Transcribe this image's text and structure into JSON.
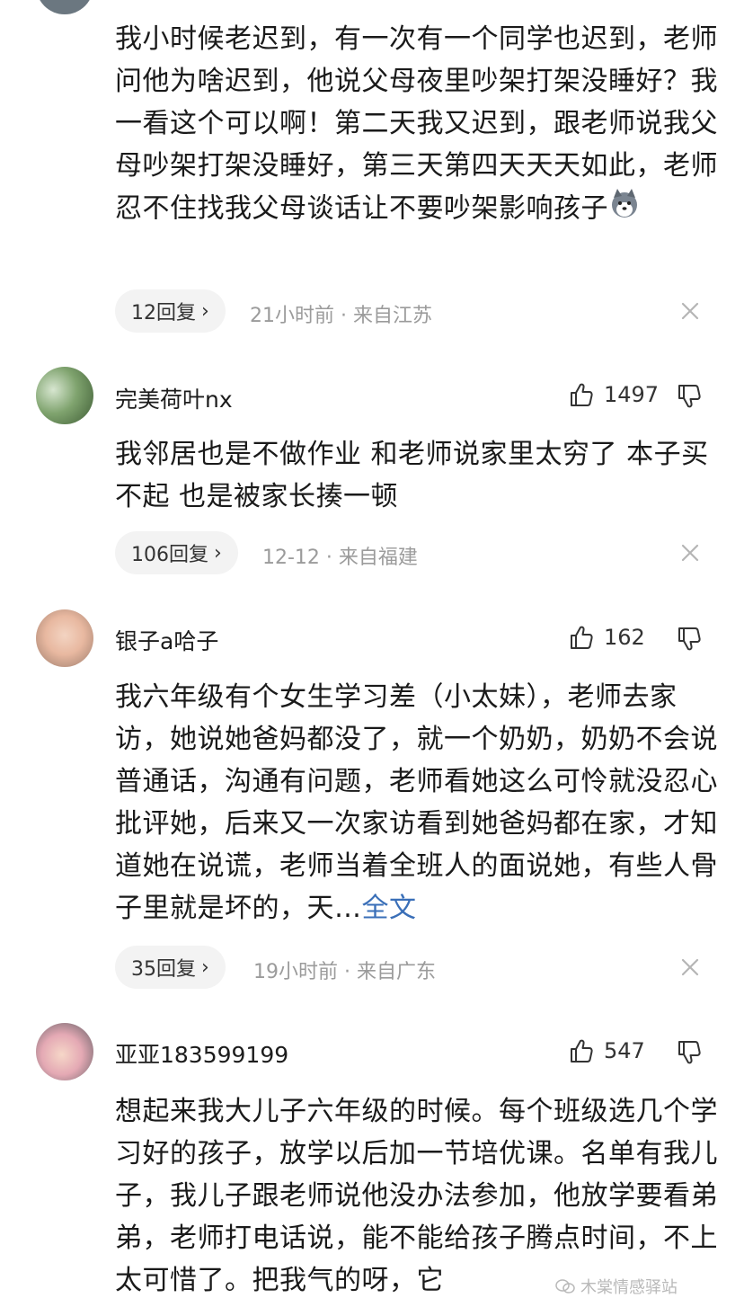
{
  "comments": [
    {
      "text": "我小时候老迟到，有一次有一个同学也迟到，老师问他为啥迟到，他说父母夜里吵架打架没睡好？我一看这个可以啊！第二天我又迟到，跟老师说我父母吵架打架没睡好，第三天第四天天天如此，老师忍不住找我父母谈话让不要吵架影响孩子",
      "emoji": "husky-emoji",
      "replies": "12回复",
      "meta": "21小时前 · 来自江苏"
    },
    {
      "user": "完美荷叶nx",
      "likes": "1497",
      "text": "我邻居也是不做作业 和老师说家里太穷了 本子买不起 也是被家长揍一顿",
      "replies": "106回复",
      "meta": "12-12 · 来自福建"
    },
    {
      "user": "银子a哈子",
      "likes": "162",
      "text": "我六年级有个女生学习差（小太妹），老师去家访，她说她爸妈都没了，就一个奶奶，奶奶不会说普通话，沟通有问题，老师看她这么可怜就没忍心批评她，后来又一次家访看到她爸妈都在家，才知道她在说谎，老师当着全班人的面说她，有些人骨子里就是坏的，天…",
      "more": "全文",
      "replies": "35回复",
      "meta": "19小时前 · 来自广东"
    },
    {
      "user": "亚亚183599199",
      "likes": "547",
      "text": "想起来我大儿子六年级的时候。每个班级选几个学习好的孩子，放学以后加一节培优课。名单有我儿子，我儿子跟老师说他没办法参加，他放学要看弟弟，老师打电话说，能不能给孩子腾点时间，不上太可惜了。把我气的呀，它"
    }
  ],
  "watermark": "木棠情感驿站",
  "icons": {
    "like": "thumbs-up-icon",
    "dislike": "thumbs-down-icon",
    "close": "close-icon"
  }
}
